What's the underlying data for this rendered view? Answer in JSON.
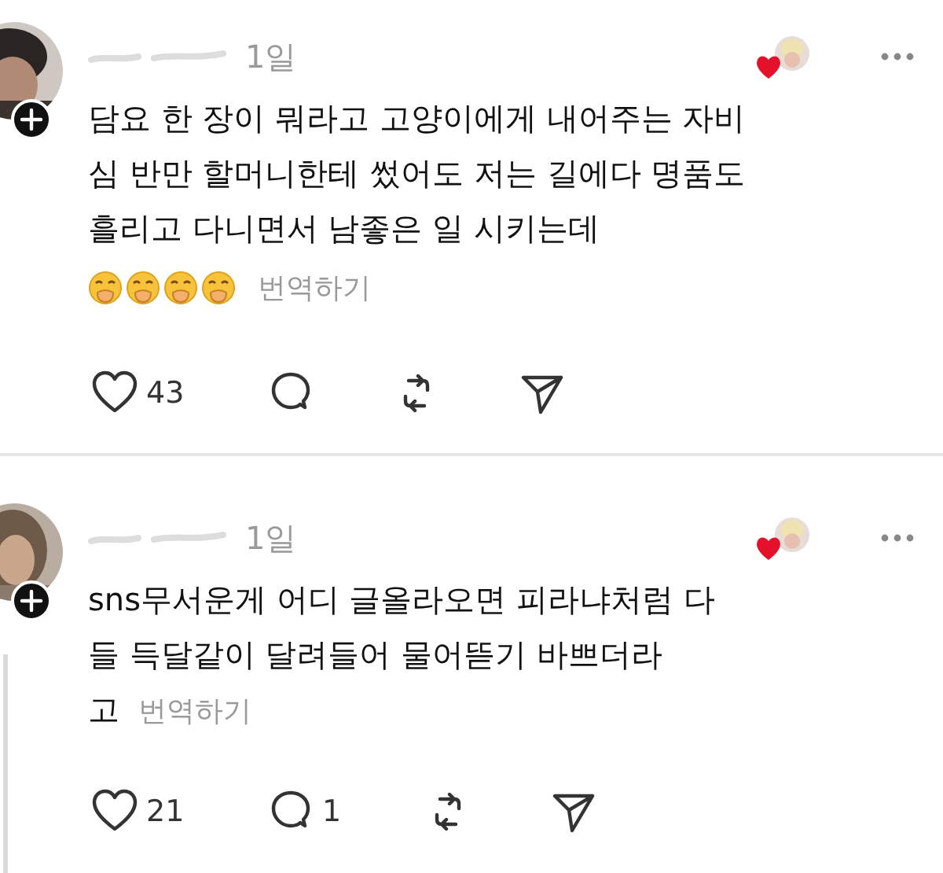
{
  "posts": [
    {
      "time": "1일",
      "lines": [
        "담요 한 장이 뭐라고 고양이에게 내어주는 자비",
        "심 반만 할머니한테 썼어도 저는 길에다 명품도",
        "흘리고 다니면서 남좋은 일 시키는데"
      ],
      "emoji_line": true,
      "translate": "번역하기",
      "thread_line": false,
      "actions": {
        "likes": "43"
      }
    },
    {
      "time": "1일",
      "lines": [
        "sns무서운게 어디 글올라오면 피라냐처럼 다",
        "들 득달같이 달려들어 물어뜯기 바쁘더라",
        "고"
      ],
      "emoji_line": false,
      "translate": "번역하기",
      "thread_line": true,
      "actions": {
        "likes": "21",
        "replies": "1"
      }
    }
  ]
}
